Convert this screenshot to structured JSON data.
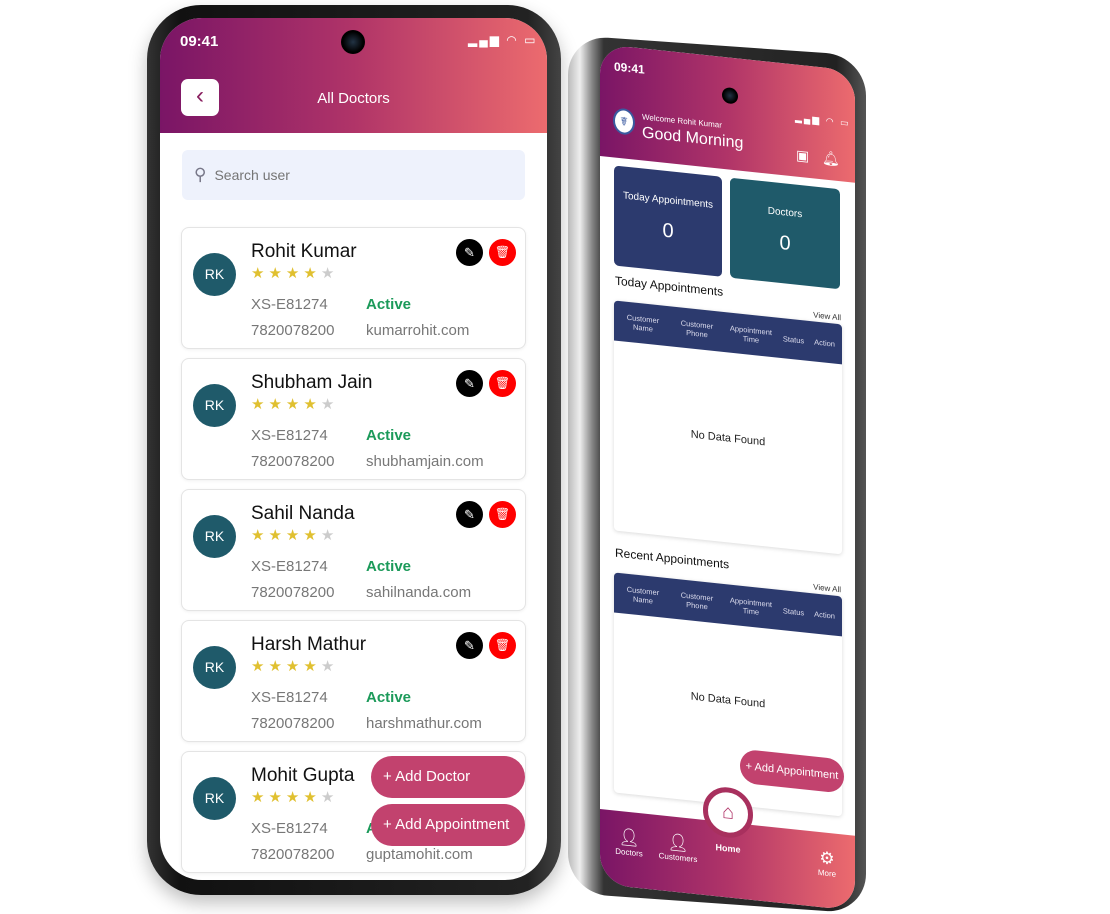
{
  "left_phone": {
    "status_time": "09:41",
    "title": "All Doctors",
    "search_placeholder": "Search user",
    "doctors": [
      {
        "initials": "RK",
        "name": "Rohit Kumar",
        "rating": 4,
        "id": "XS-E81274",
        "status": "Active",
        "phone": "7820078200",
        "website": "kumarrohit.com"
      },
      {
        "initials": "RK",
        "name": "Shubham Jain",
        "rating": 4,
        "id": "XS-E81274",
        "status": "Active",
        "phone": "7820078200",
        "website": "shubhamjain.com"
      },
      {
        "initials": "RK",
        "name": "Sahil Nanda",
        "rating": 4,
        "id": "XS-E81274",
        "status": "Active",
        "phone": "7820078200",
        "website": "sahilnanda.com"
      },
      {
        "initials": "RK",
        "name": "Harsh Mathur",
        "rating": 4,
        "id": "XS-E81274",
        "status": "Active",
        "phone": "7820078200",
        "website": "harshmathur.com"
      },
      {
        "initials": "RK",
        "name": "Mohit Gupta",
        "rating": 4,
        "id": "XS-E81274",
        "status": "Active",
        "phone": "7820078200",
        "website": "guptamohit.com"
      }
    ],
    "add_doctor_label": "+ Add Doctor",
    "add_appointment_label": "+ Add Appointment"
  },
  "right_phone": {
    "status_time": "09:41",
    "welcome": "Welcome Rohit Kumar",
    "greeting": "Good Morning",
    "stats": [
      {
        "label": "Today Appointments",
        "value": "0",
        "color": "#2c3a6e"
      },
      {
        "label": "Doctors",
        "value": "0",
        "color": "#1f5a6a"
      }
    ],
    "today_section": {
      "title": "Today Appointments",
      "view_all": "View All",
      "empty": "No Data Found"
    },
    "recent_section": {
      "title": "Recent Appointments",
      "view_all": "View All",
      "empty": "No Data Found"
    },
    "columns": [
      "Customer Name",
      "Customer Phone",
      "Appointment Time",
      "Status",
      "Action"
    ],
    "add_appointment_label": "+ Add Appointment",
    "nav": {
      "doctors": "Doctors",
      "customers": "Customers",
      "home": "Home",
      "more": "More"
    }
  },
  "colors": {
    "gradient_start": "#7a1566",
    "gradient_end": "#ec6b6e",
    "accent": "#c2426e",
    "active": "#1c9a5a"
  }
}
